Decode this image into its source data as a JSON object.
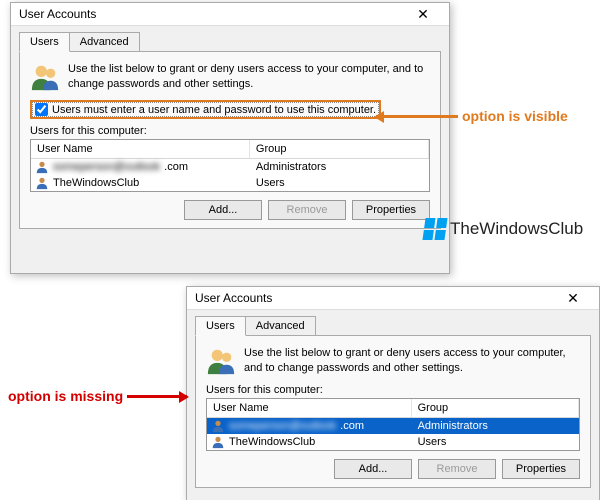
{
  "dialog1": {
    "title": "User Accounts",
    "tabs": {
      "users": "Users",
      "advanced": "Advanced"
    },
    "intro": "Use the list below to grant or deny users access to your computer, and to change passwords and other settings.",
    "checkbox_label": "Users must enter a user name and password to use this computer.",
    "users_label": "Users for this computer:",
    "columns": {
      "name": "User Name",
      "group": "Group"
    },
    "rows": [
      {
        "name_suffix": ".com",
        "group": "Administrators"
      },
      {
        "name": "TheWindowsClub",
        "group": "Users"
      }
    ],
    "buttons": {
      "add": "Add...",
      "remove": "Remove",
      "properties": "Properties"
    }
  },
  "dialog2": {
    "title": "User Accounts",
    "tabs": {
      "users": "Users",
      "advanced": "Advanced"
    },
    "intro": "Use the list below to grant or deny users access to your computer, and to change passwords and other settings.",
    "users_label": "Users for this computer:",
    "columns": {
      "name": "User Name",
      "group": "Group"
    },
    "rows": [
      {
        "name_suffix": ".com",
        "group": "Administrators"
      },
      {
        "name": "TheWindowsClub",
        "group": "Users"
      }
    ],
    "buttons": {
      "add": "Add...",
      "remove": "Remove",
      "properties": "Properties"
    }
  },
  "annotations": {
    "visible": "option is visible",
    "missing": "option is missing"
  },
  "watermark": "TheWindowsClub"
}
